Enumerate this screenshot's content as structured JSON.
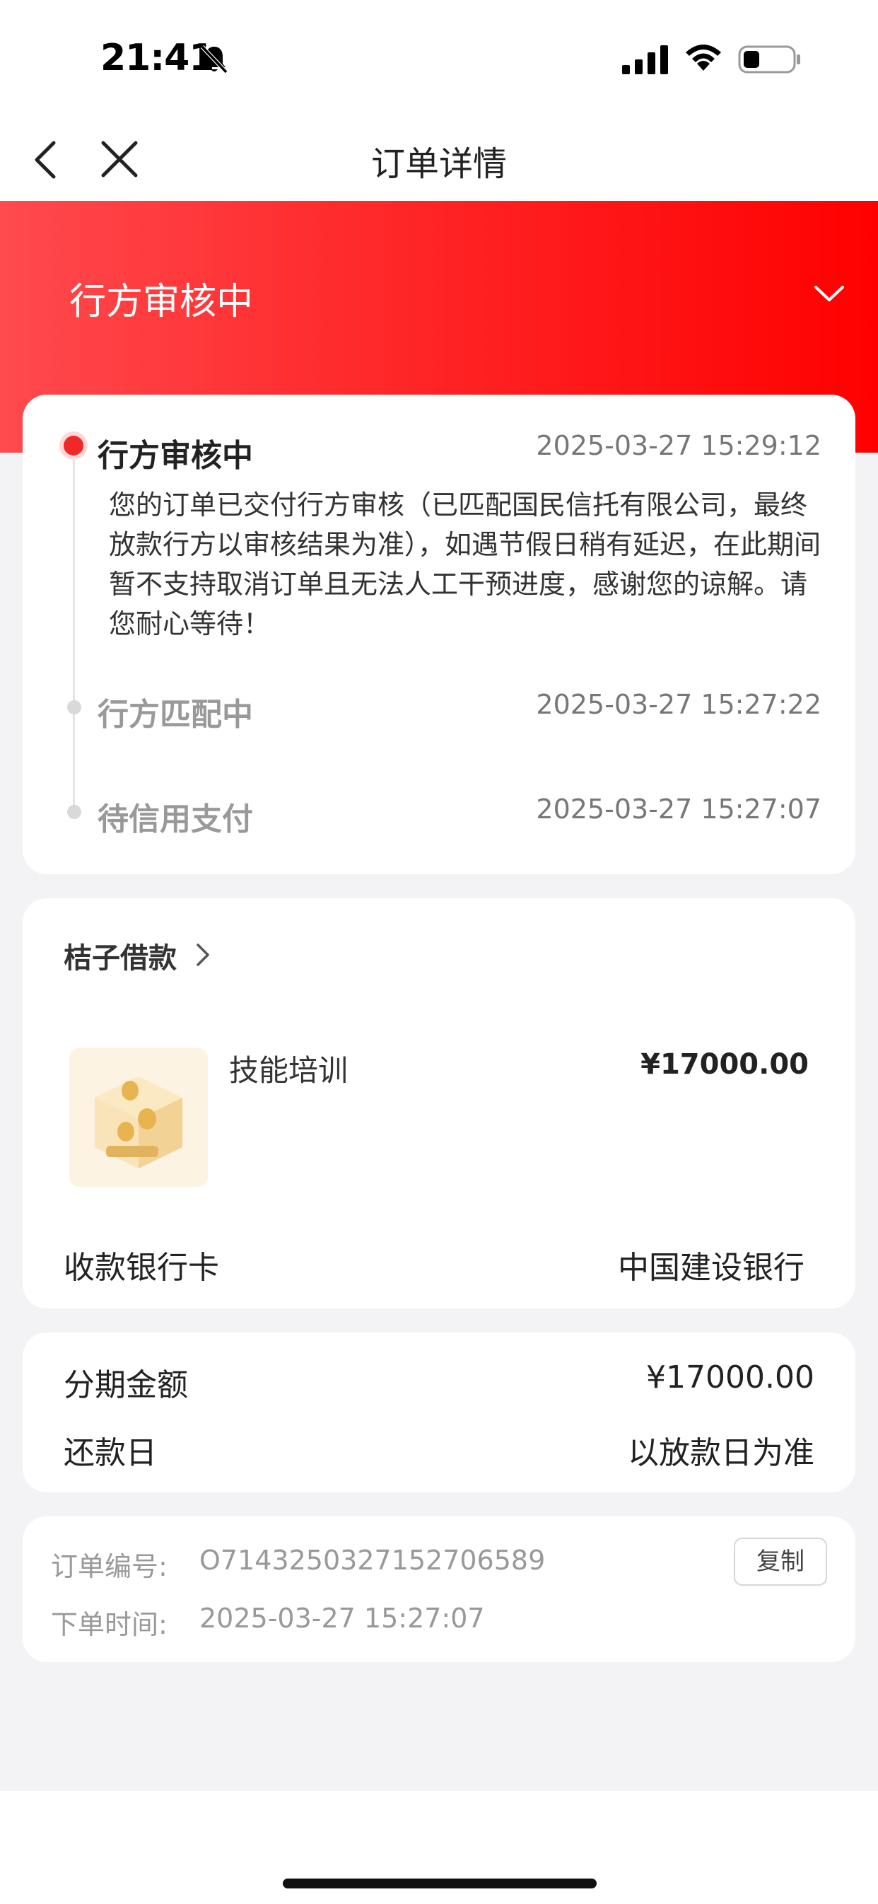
{
  "status_bar": {
    "time": "21:41"
  },
  "nav": {
    "title": "订单详情"
  },
  "hero": {
    "status_title": "行方审核中"
  },
  "timeline": [
    {
      "title": "行方审核中",
      "time": "2025-03-27 15:29:12",
      "desc": "您的订单已交付行方审核（已匹配国民信托有限公司，最终放款行方以审核结果为准），如遇节假日稍有延迟，在此期间暂不支持取消订单且无法人工干预进度，感谢您的谅解。请您耐心等待！"
    },
    {
      "title": "行方匹配中",
      "time": "2025-03-27 15:27:22"
    },
    {
      "title": "待信用支付",
      "time": "2025-03-27 15:27:07"
    }
  ],
  "product": {
    "merchant": "桔子借款",
    "name": "技能培训",
    "price": "¥17000.00",
    "bank_label": "收款银行卡",
    "bank_value": "中国建设银行"
  },
  "installment": {
    "amount_label": "分期金额",
    "amount_value": "¥17000.00",
    "repay_label": "还款日",
    "repay_value": "以放款日为准"
  },
  "order_info": {
    "number_label": "订单编号:",
    "number_value": "O7143250327152706589",
    "copy_label": "复制",
    "time_label": "下单时间:",
    "time_value": "2025-03-27 15:27:07"
  },
  "colors": {
    "accent": "#ff0000",
    "active_dot": "#f02828"
  }
}
